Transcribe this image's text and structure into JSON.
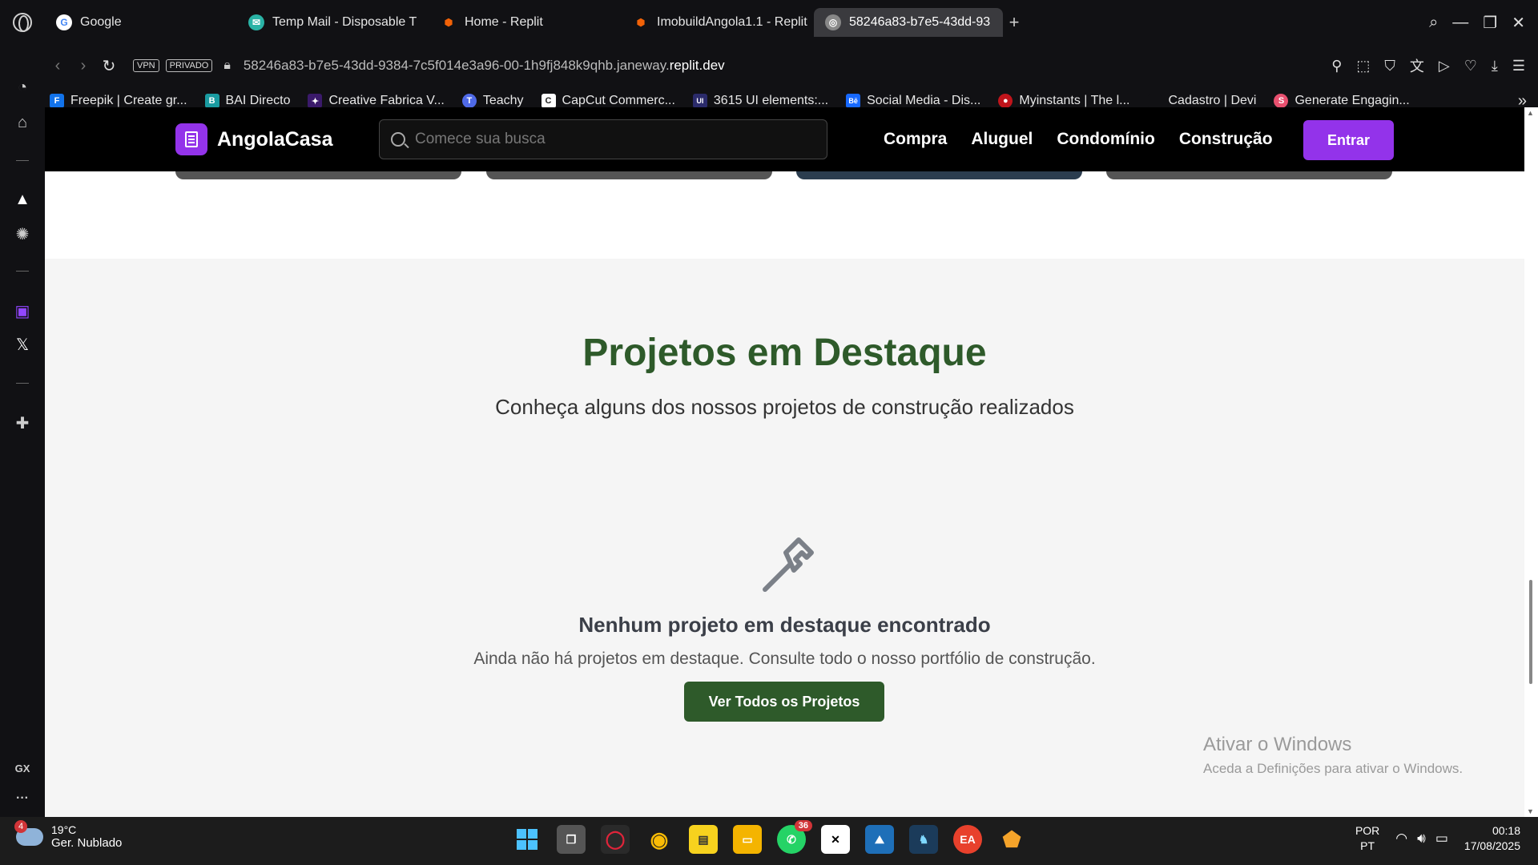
{
  "browser": {
    "tabs": [
      {
        "label": "Google",
        "icon": "google-icon",
        "color": "#ffffff"
      },
      {
        "label": "Temp Mail - Disposable T",
        "icon": "tempmail-icon",
        "color": "#2ab3a6"
      },
      {
        "label": "Home - Replit",
        "icon": "replit-icon",
        "color": "#f26207"
      },
      {
        "label": "ImobuildAngola1.1 - Replit",
        "icon": "replit-icon",
        "color": "#f26207"
      },
      {
        "label": "58246a83-b7e5-43dd-93",
        "icon": "globe-icon",
        "color": "#888888",
        "active": true
      }
    ],
    "new_tab": "+",
    "vpn_badge": "VPN",
    "private_badge": "PRIVADO",
    "url_prefix": "58246a83-b7e5-43dd-9384-7c5f014e3a96-00-1h9fj848k9qhb.janeway.",
    "url_domain": "replit.dev",
    "bookmarks": [
      {
        "label": "Freepik | Create gr...",
        "color": "#1273eb",
        "glyph": "F"
      },
      {
        "label": "BAI Directo",
        "color": "#1a9ba1",
        "glyph": "B"
      },
      {
        "label": "Creative Fabrica V...",
        "color": "#3b1a6b",
        "glyph": "✦"
      },
      {
        "label": "Teachy",
        "color": "#4f6ae8",
        "glyph": "T"
      },
      {
        "label": "CapCut Commerc...",
        "color": "#222222",
        "glyph": "C"
      },
      {
        "label": "3615 UI elements:...",
        "color": "#2b2b6b",
        "glyph": "UI"
      },
      {
        "label": "Social Media - Dis...",
        "color": "#1769ff",
        "glyph": "Bē"
      },
      {
        "label": "Myinstants | The l...",
        "color": "#c0141b",
        "glyph": "●"
      },
      {
        "label": "Cadastro | Devi",
        "color": "#111114",
        "glyph": " "
      },
      {
        "label": "Generate Engagin...",
        "color": "#e8506f",
        "glyph": "S"
      }
    ],
    "bookmarks_more": "»"
  },
  "site": {
    "logo_text": "AngolaCasa",
    "search_placeholder": "Comece sua busca",
    "nav": [
      "Compra",
      "Aluguel",
      "Condomínio",
      "Construção"
    ],
    "login_button": "Entrar",
    "accent": "#9333ea"
  },
  "featured": {
    "title": "Projetos em Destaque",
    "subtitle": "Conheça alguns dos nossos projetos de construção realizados",
    "empty_title": "Nenhum projeto em destaque encontrado",
    "empty_text": "Ainda não há projetos em destaque. Consulte todo o nosso portfólio de construção.",
    "button": "Ver Todos os Projetos",
    "accent": "#2e5a2a"
  },
  "watermark": {
    "line1": "Ativar o Windows",
    "line2": "Aceda a Definições para ativar o Windows."
  },
  "taskbar": {
    "weather_badge": "4",
    "temperature": "19°C",
    "condition": "Ger. Nublado",
    "whatsapp_badge": "36",
    "lang1": "POR",
    "lang2": "PT",
    "time": "00:18",
    "date": "17/08/2025",
    "sidebar_gx": "GX",
    "sidebar_more": "···"
  }
}
